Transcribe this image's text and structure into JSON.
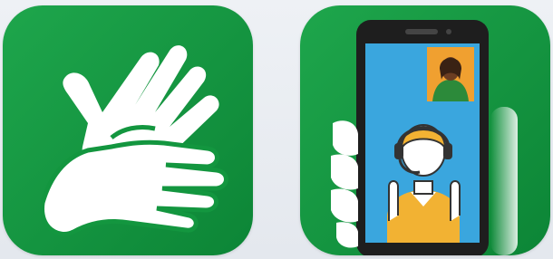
{
  "apps": [
    {
      "icon": "sign-language-hands-icon",
      "background": "#13963f"
    },
    {
      "icon": "video-relay-phone-icon",
      "background": "#13963f",
      "screen_color": "#3aa6de",
      "operator_shirt": "#f2b233",
      "caller_bg": "#f0a030"
    }
  ]
}
